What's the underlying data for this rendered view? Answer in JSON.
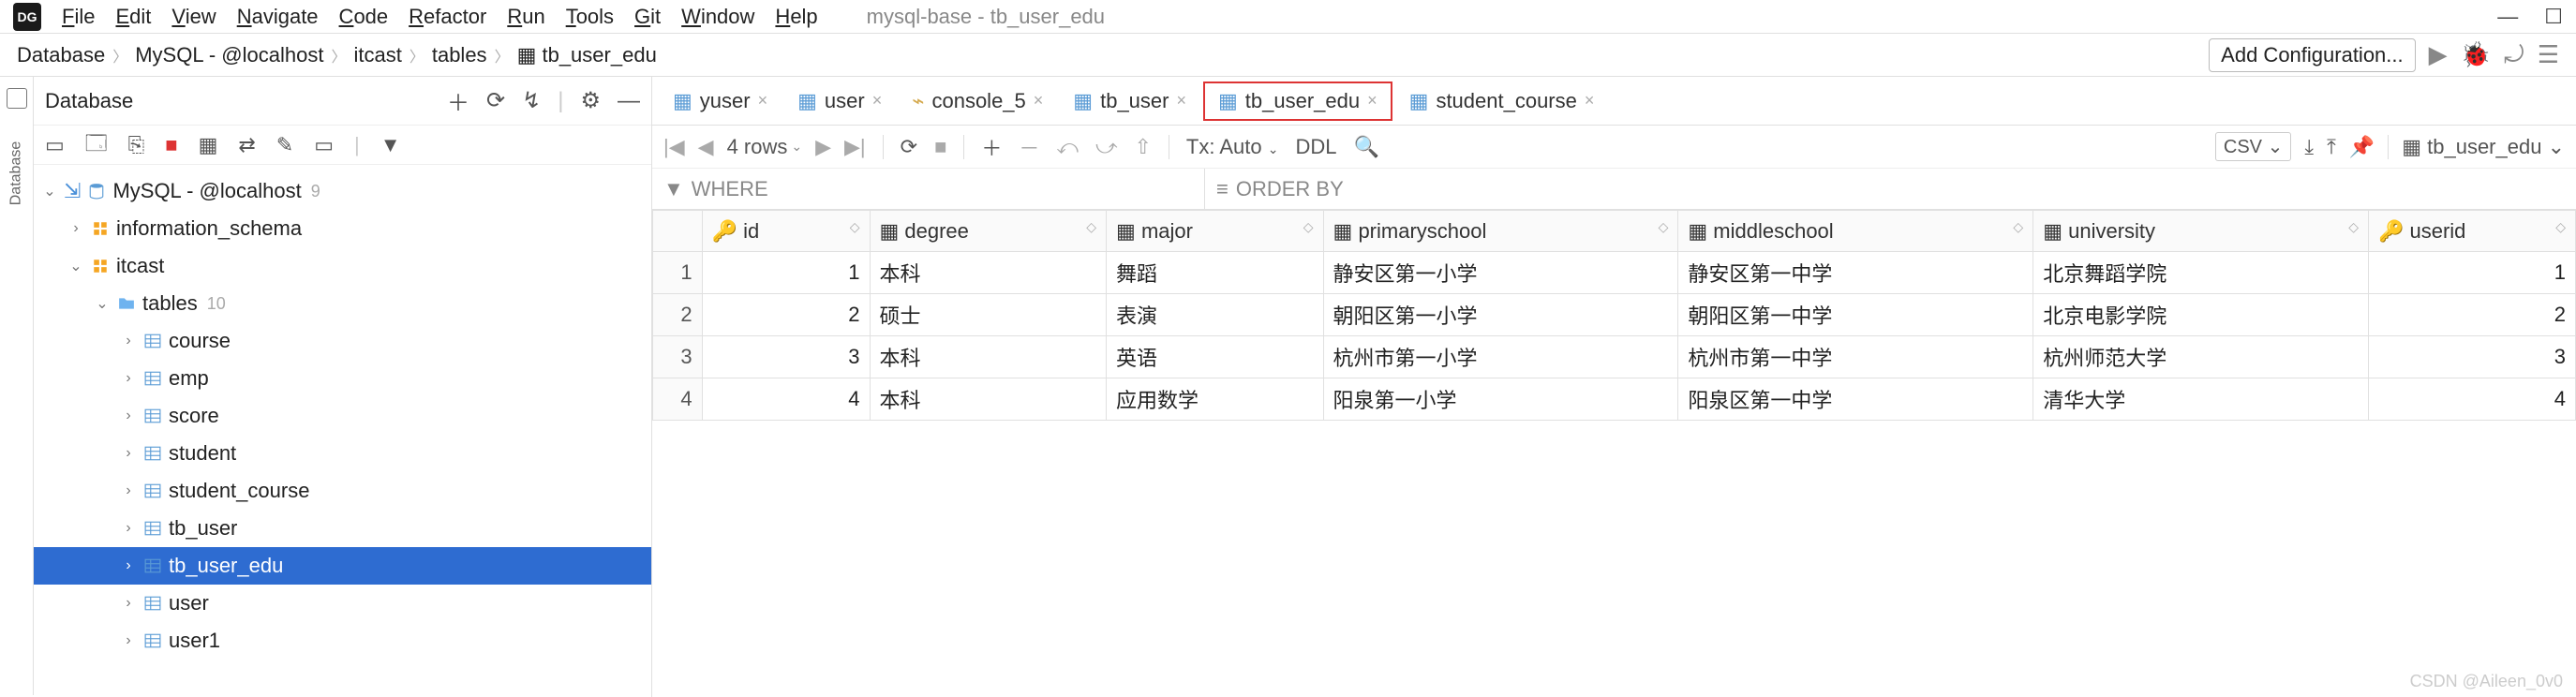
{
  "window": {
    "title": "mysql-base - tb_user_edu"
  },
  "menubar": [
    "File",
    "Edit",
    "View",
    "Navigate",
    "Code",
    "Refactor",
    "Run",
    "Tools",
    "Git",
    "Window",
    "Help"
  ],
  "breadcrumbs": [
    "Database",
    "MySQL - @localhost",
    "itcast",
    "tables",
    "tb_user_edu"
  ],
  "add_conf": "Add Configuration...",
  "sidebar": {
    "title": "Database",
    "tree": {
      "root": {
        "label": "MySQL - @localhost",
        "badge": "9"
      },
      "schemas": [
        "information_schema",
        "itcast"
      ],
      "tables_label": "tables",
      "tables_count": "10",
      "tables": [
        "course",
        "emp",
        "score",
        "student",
        "student_course",
        "tb_user",
        "tb_user_edu",
        "user",
        "user1"
      ],
      "selected": "tb_user_edu"
    }
  },
  "tabs": [
    {
      "label": "yuser",
      "icon": "table"
    },
    {
      "label": "user",
      "icon": "table"
    },
    {
      "label": "console_5",
      "icon": "console"
    },
    {
      "label": "tb_user",
      "icon": "table"
    },
    {
      "label": "tb_user_edu",
      "icon": "table",
      "active": true
    },
    {
      "label": "student_course",
      "icon": "table"
    }
  ],
  "editor_toolbar": {
    "rows": "4 rows",
    "tx": "Tx: Auto",
    "ddl": "DDL",
    "csv": "CSV",
    "context": "tb_user_edu"
  },
  "filters": {
    "where": "WHERE",
    "order": "ORDER BY"
  },
  "columns": [
    "id",
    "degree",
    "major",
    "primaryschool",
    "middleschool",
    "university",
    "userid"
  ],
  "rows": [
    {
      "id": "1",
      "degree": "本科",
      "major": "舞蹈",
      "primaryschool": "静安区第一小学",
      "middleschool": "静安区第一中学",
      "university": "北京舞蹈学院",
      "userid": "1"
    },
    {
      "id": "2",
      "degree": "硕士",
      "major": "表演",
      "primaryschool": "朝阳区第一小学",
      "middleschool": "朝阳区第一中学",
      "university": "北京电影学院",
      "userid": "2"
    },
    {
      "id": "3",
      "degree": "本科",
      "major": "英语",
      "primaryschool": "杭州市第一小学",
      "middleschool": "杭州市第一中学",
      "university": "杭州师范大学",
      "userid": "3"
    },
    {
      "id": "4",
      "degree": "本科",
      "major": "应用数学",
      "primaryschool": "阳泉第一小学",
      "middleschool": "阳泉区第一中学",
      "university": "清华大学",
      "userid": "4"
    }
  ],
  "watermark": "CSDN @Aileen_0v0"
}
